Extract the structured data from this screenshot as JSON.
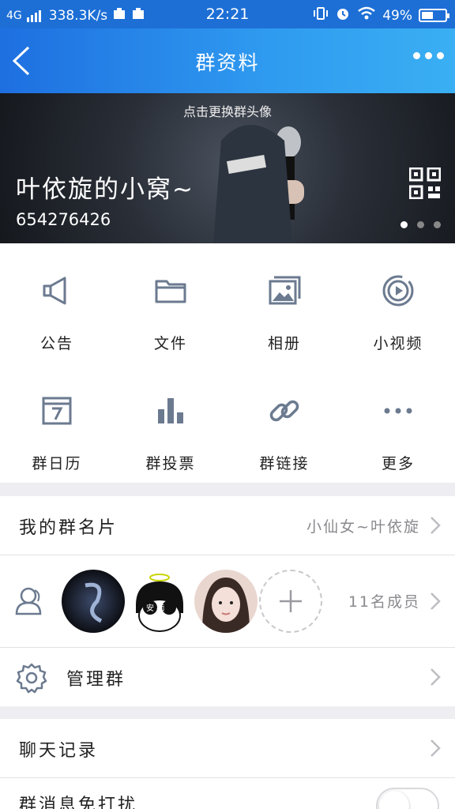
{
  "statusbar": {
    "network": "4G",
    "speed": "338.3K/s",
    "time": "22:21",
    "battery": "49%",
    "battery_level": 0.49
  },
  "navbar": {
    "title": "群资料"
  },
  "banner": {
    "hint": "点击更换群头像",
    "group_name": "叶依旋的小窝~",
    "group_id": "654276426",
    "page_index": 1,
    "page_count": 3
  },
  "features": [
    {
      "label": "公告",
      "icon": "megaphone-icon"
    },
    {
      "label": "文件",
      "icon": "folder-icon"
    },
    {
      "label": "相册",
      "icon": "photo-album-icon"
    },
    {
      "label": "小视频",
      "icon": "video-play-icon"
    },
    {
      "label": "群日历",
      "icon": "calendar-icon"
    },
    {
      "label": "群投票",
      "icon": "bar-chart-icon"
    },
    {
      "label": "群链接",
      "icon": "link-icon"
    },
    {
      "label": "更多",
      "icon": "more-dots-icon"
    }
  ],
  "my_card": {
    "label": "我的群名片",
    "value": "小仙女~叶依旋"
  },
  "members": {
    "count_text": "11名成员",
    "avatar_badge": "安 痴"
  },
  "manage": {
    "label": "管理群"
  },
  "chat_history": {
    "label": "聊天记录"
  },
  "dnd": {
    "label": "群消息免打扰",
    "enabled": false
  },
  "colors": {
    "accent": "#2f8df0",
    "icon_gray": "#6b7a8f",
    "divider": "#e2e2e6"
  }
}
